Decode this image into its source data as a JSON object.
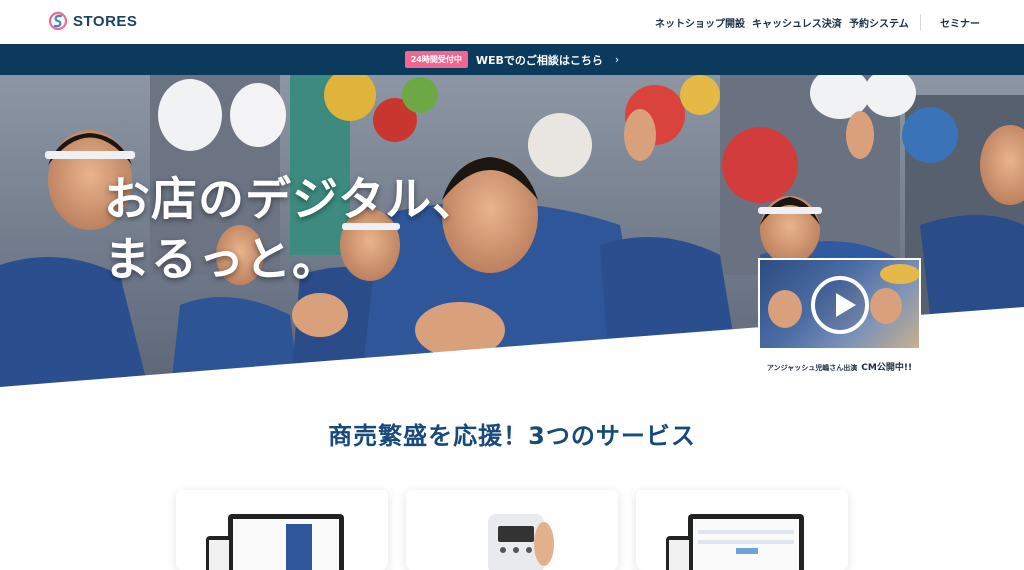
{
  "header": {
    "logo_text": "STORES",
    "logo_icon": "stores-s-icon",
    "nav": [
      "ネットショップ開設",
      "キャッシュレス決済",
      "予約システム",
      "セミナー"
    ]
  },
  "banner": {
    "badge": "24時間受付中",
    "text": "WEBでのご相談はこちら",
    "icon": "chevron-right-icon"
  },
  "hero": {
    "headline_line1": "お店のデジタル、",
    "headline_line2": "まるっと。",
    "video": {
      "icon": "play-icon",
      "caption_small": "アンジャッシュ児嶋さん出演",
      "caption_big": "CM公開中!!"
    }
  },
  "services": {
    "title": "商売繁盛を応援！3つのサービス"
  },
  "colors": {
    "navy": "#0b3a5d",
    "badge_pink": "#f0688f",
    "title_blue": "#174a7b",
    "happi_blue": "#2b4f8e"
  }
}
